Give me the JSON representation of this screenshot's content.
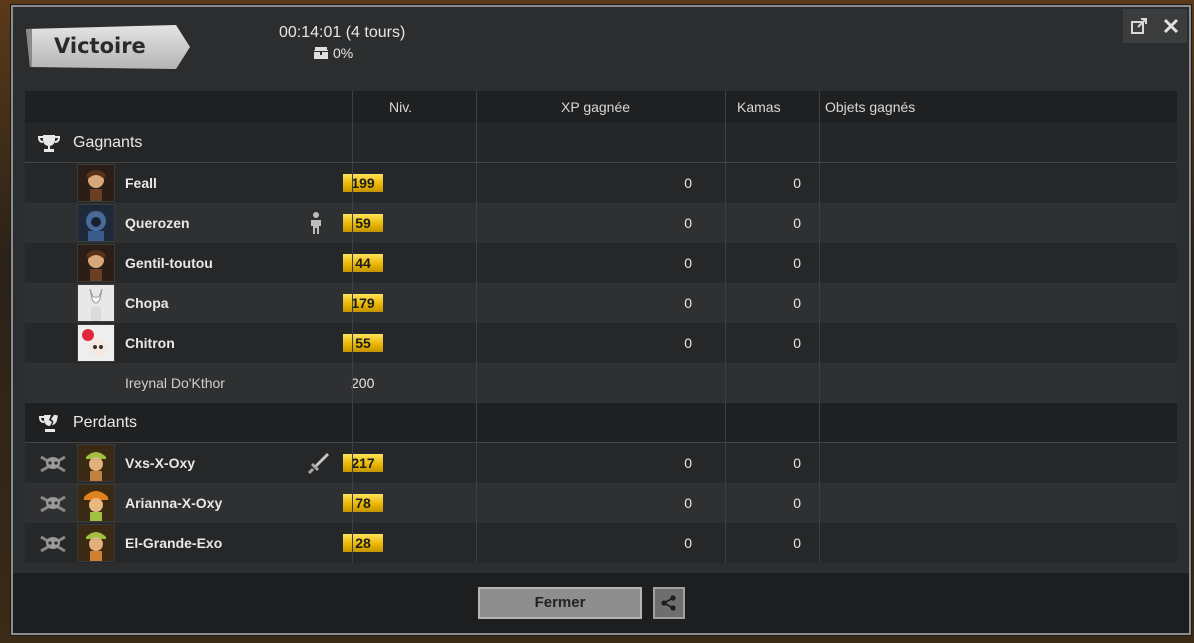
{
  "banner": {
    "title": "Victoire"
  },
  "fight": {
    "time": "00:14:01 (4 tours)",
    "chest_percent": "0%"
  },
  "table": {
    "headers": {
      "level": "Niv.",
      "xp": "XP gagnée",
      "kamas": "Kamas",
      "items": "Objets gagnés"
    }
  },
  "winners": {
    "label": "Gagnants",
    "rows": [
      {
        "name": "Feall",
        "level": "199",
        "xp": "0",
        "kamas": "0"
      },
      {
        "name": "Querozen",
        "level": "59",
        "xp": "0",
        "kamas": "0"
      },
      {
        "name": "Gentil-toutou",
        "level": "44",
        "xp": "0",
        "kamas": "0"
      },
      {
        "name": "Chopa",
        "level": "179",
        "xp": "0",
        "kamas": "0"
      },
      {
        "name": "Chitron",
        "level": "55",
        "xp": "0",
        "kamas": "0"
      }
    ],
    "ally": {
      "name": "Ireynal Do'Kthor",
      "level": "200"
    }
  },
  "losers": {
    "label": "Perdants",
    "rows": [
      {
        "name": "Vxs-X-Oxy",
        "level": "217",
        "xp": "0",
        "kamas": "0"
      },
      {
        "name": "Arianna-X-Oxy",
        "level": "78",
        "xp": "0",
        "kamas": "0"
      },
      {
        "name": "El-Grande-Exo",
        "level": "28",
        "xp": "0",
        "kamas": "0"
      }
    ]
  },
  "footer": {
    "close_label": "Fermer"
  },
  "colors": {
    "level_badge": "#f0c000",
    "window_bg": "#2c2d2f",
    "header_bg": "#1f2021"
  }
}
